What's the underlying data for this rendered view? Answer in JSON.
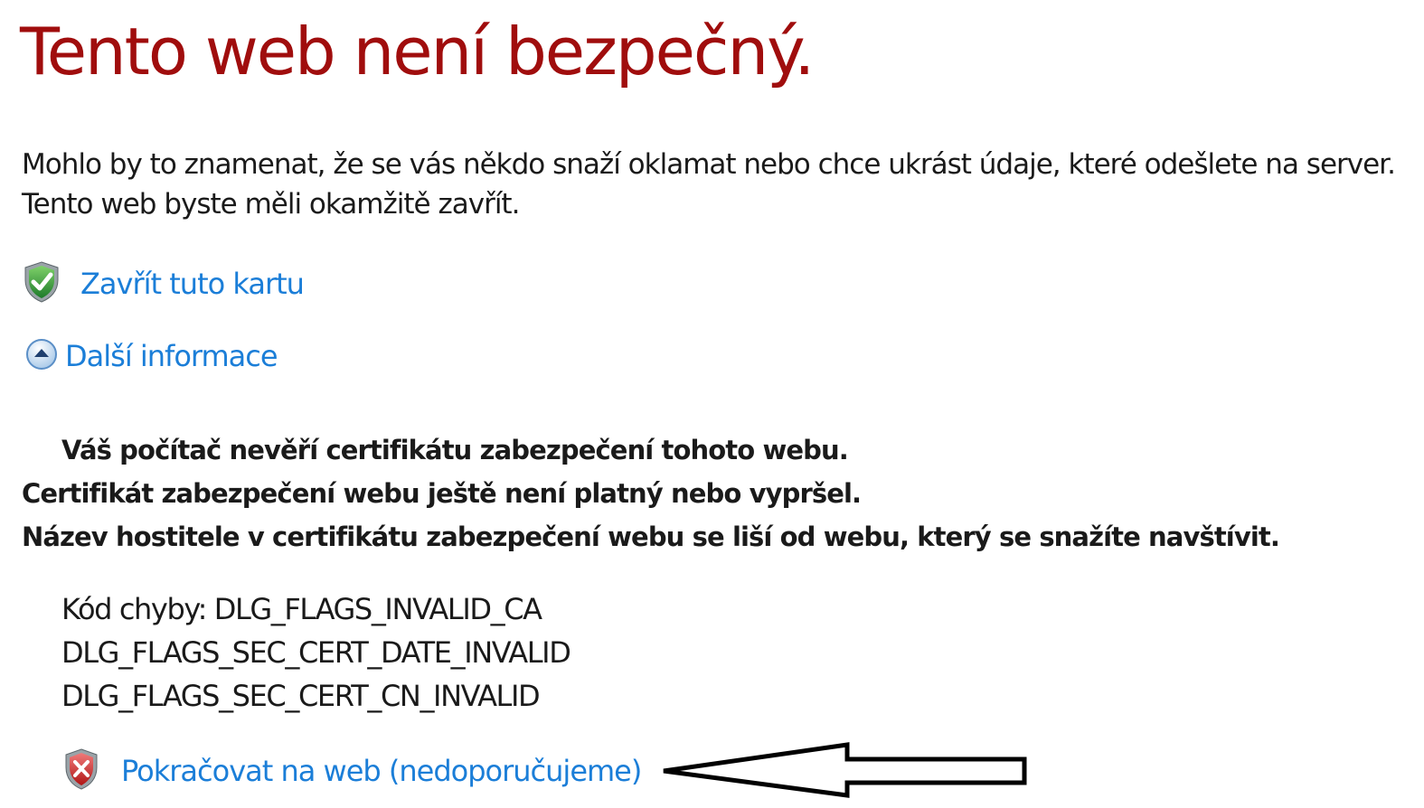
{
  "page": {
    "title": "Tento web není bezpečný.",
    "description": [
      "Mohlo by to znamenat, že se vás někdo snaží oklamat nebo chce ukrást údaje, které odešlete na server.",
      "Tento web byste měli okamžitě zavřít."
    ]
  },
  "actions": {
    "close_tab": {
      "label": "Zavřít tuto kartu",
      "icon": "green-shield-check-icon"
    },
    "more_info": {
      "label": "Další informace",
      "icon": "collapse-up-icon"
    },
    "continue": {
      "label": "Pokračovat na web (nedoporučujeme)",
      "icon": "red-shield-x-icon"
    }
  },
  "details": {
    "reasons": [
      "Váš počítač nevěří certifikátu zabezpečení tohoto webu.",
      "Certifikát zabezpečení webu ještě není platný nebo vypršel.",
      "Název hostitele v certifikátu zabezpečení webu se liší od webu, který se snažíte navštívit."
    ],
    "error_codes": [
      "Kód chyby: DLG_FLAGS_INVALID_CA",
      "DLG_FLAGS_SEC_CERT_DATE_INVALID",
      "DLG_FLAGS_SEC_CERT_CN_INVALID"
    ]
  },
  "colors": {
    "title": "#a00d0d",
    "link": "#1b7ed8",
    "text": "#1a1a1a"
  },
  "annotation": {
    "arrow": "arrow-left-pointer"
  }
}
